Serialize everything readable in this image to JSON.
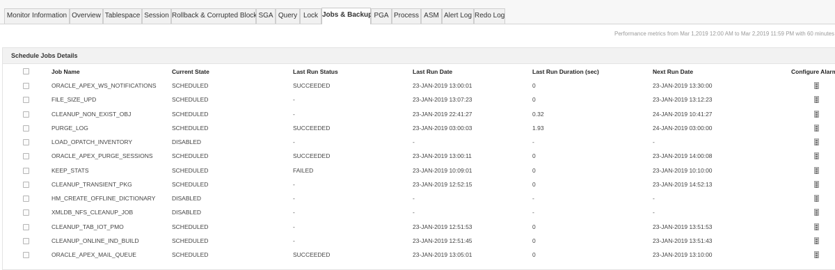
{
  "tabs": [
    {
      "label": "Monitor Information",
      "active": false
    },
    {
      "label": "Overview",
      "active": false
    },
    {
      "label": "Tablespace",
      "active": false
    },
    {
      "label": "Session",
      "active": false
    },
    {
      "label": "Rollback & Corrupted Blocks",
      "active": false
    },
    {
      "label": "SGA",
      "active": false
    },
    {
      "label": "Query",
      "active": false
    },
    {
      "label": "Lock",
      "active": false
    },
    {
      "label": "Jobs & Backup",
      "active": true
    },
    {
      "label": "PGA",
      "active": false
    },
    {
      "label": "Process",
      "active": false
    },
    {
      "label": "ASM",
      "active": false
    },
    {
      "label": "Alert Log",
      "active": false
    },
    {
      "label": "Redo Log",
      "active": false
    }
  ],
  "performance_note": "Performance metrics from Mar 1,2019 12:00 AM to Mar 2,2019 11:59 PM with 60 minutes",
  "panel": {
    "title": "Schedule Jobs Details",
    "columns": {
      "job_name": "Job Name",
      "current_state": "Current State",
      "last_run_status": "Last Run Status",
      "last_run_date": "Last Run Date",
      "last_run_duration": "Last Run Duration  (sec)",
      "next_run_date": "Next Run Date",
      "configure_alarms": "Configure Alarms"
    },
    "rows": [
      {
        "job_name": "ORACLE_APEX_WS_NOTIFICATIONS",
        "current_state": "SCHEDULED",
        "last_run_status": "SUCCEEDED",
        "last_run_date": "23-JAN-2019 13:00:01",
        "last_run_duration": "0",
        "next_run_date": "23-JAN-2019 13:30:00"
      },
      {
        "job_name": "FILE_SIZE_UPD",
        "current_state": "SCHEDULED",
        "last_run_status": "-",
        "last_run_date": "23-JAN-2019 13:07:23",
        "last_run_duration": "0",
        "next_run_date": "23-JAN-2019 13:12:23"
      },
      {
        "job_name": "CLEANUP_NON_EXIST_OBJ",
        "current_state": "SCHEDULED",
        "last_run_status": "-",
        "last_run_date": "23-JAN-2019 22:41:27",
        "last_run_duration": "0.32",
        "next_run_date": "24-JAN-2019 10:41:27"
      },
      {
        "job_name": "PURGE_LOG",
        "current_state": "SCHEDULED",
        "last_run_status": "SUCCEEDED",
        "last_run_date": "23-JAN-2019 03:00:03",
        "last_run_duration": "1.93",
        "next_run_date": "24-JAN-2019 03:00:00"
      },
      {
        "job_name": "LOAD_OPATCH_INVENTORY",
        "current_state": "DISABLED",
        "last_run_status": "-",
        "last_run_date": "-",
        "last_run_duration": "-",
        "next_run_date": "-"
      },
      {
        "job_name": "ORACLE_APEX_PURGE_SESSIONS",
        "current_state": "SCHEDULED",
        "last_run_status": "SUCCEEDED",
        "last_run_date": "23-JAN-2019 13:00:11",
        "last_run_duration": "0",
        "next_run_date": "23-JAN-2019 14:00:08"
      },
      {
        "job_name": "KEEP_STATS",
        "current_state": "SCHEDULED",
        "last_run_status": "FAILED",
        "last_run_date": "23-JAN-2019 10:09:01",
        "last_run_duration": "0",
        "next_run_date": "23-JAN-2019 10:10:00"
      },
      {
        "job_name": "CLEANUP_TRANSIENT_PKG",
        "current_state": "SCHEDULED",
        "last_run_status": "-",
        "last_run_date": "23-JAN-2019 12:52:15",
        "last_run_duration": "0",
        "next_run_date": "23-JAN-2019 14:52:13"
      },
      {
        "job_name": "HM_CREATE_OFFLINE_DICTIONARY",
        "current_state": "DISABLED",
        "last_run_status": "-",
        "last_run_date": "-",
        "last_run_duration": "-",
        "next_run_date": "-"
      },
      {
        "job_name": "XMLDB_NFS_CLEANUP_JOB",
        "current_state": "DISABLED",
        "last_run_status": "-",
        "last_run_date": "-",
        "last_run_duration": "-",
        "next_run_date": "-"
      },
      {
        "job_name": "CLEANUP_TAB_IOT_PMO",
        "current_state": "SCHEDULED",
        "last_run_status": "-",
        "last_run_date": "23-JAN-2019 12:51:53",
        "last_run_duration": "0",
        "next_run_date": "23-JAN-2019 13:51:53"
      },
      {
        "job_name": "CLEANUP_ONLINE_IND_BUILD",
        "current_state": "SCHEDULED",
        "last_run_status": "-",
        "last_run_date": "23-JAN-2019 12:51:45",
        "last_run_duration": "0",
        "next_run_date": "23-JAN-2019 13:51:43"
      },
      {
        "job_name": "ORACLE_APEX_MAIL_QUEUE",
        "current_state": "SCHEDULED",
        "last_run_status": "SUCCEEDED",
        "last_run_date": "23-JAN-2019 13:05:01",
        "last_run_duration": "0",
        "next_run_date": "23-JAN-2019 13:10:00"
      }
    ],
    "row_icon": "alarm-config-icon"
  }
}
